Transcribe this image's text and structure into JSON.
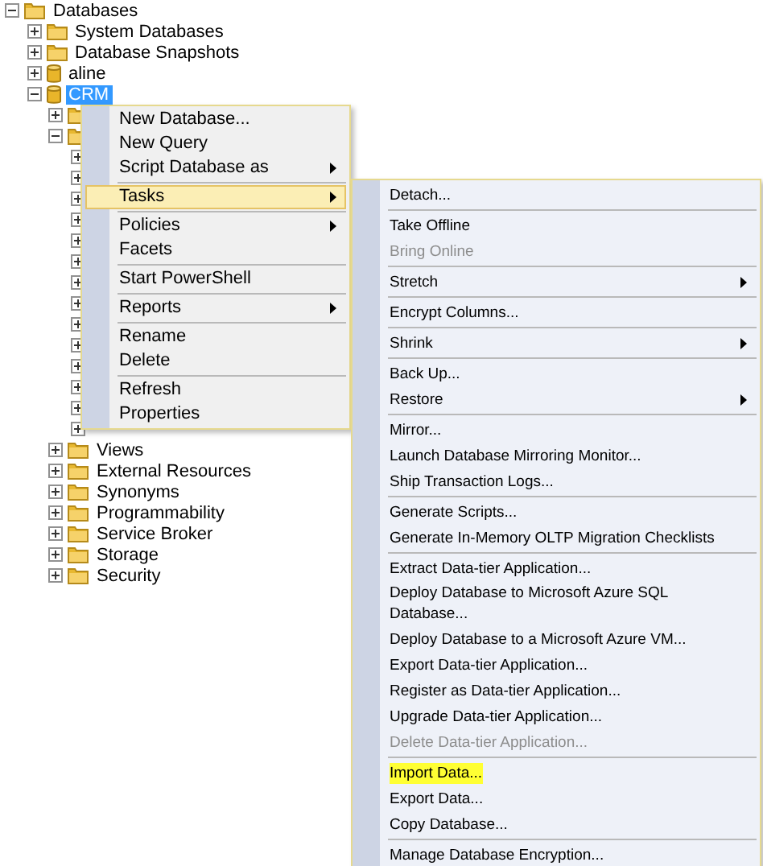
{
  "tree": [
    {
      "label": "Databases",
      "kind": "folder",
      "expanded": true,
      "selected": false,
      "children": [
        {
          "label": "System Databases",
          "kind": "folder",
          "expanded": false,
          "selected": false
        },
        {
          "label": "Database Snapshots",
          "kind": "folder",
          "expanded": false,
          "selected": false
        },
        {
          "label": "aline",
          "kind": "database",
          "expanded": false,
          "selected": false
        },
        {
          "label": "CRM",
          "kind": "database",
          "expanded": true,
          "selected": true,
          "children": [
            {
              "kind": "folder",
              "expanded": false
            },
            {
              "kind": "folder",
              "expanded": true,
              "children": [
                {
                  "expanded": false
                },
                {
                  "expanded": false
                },
                {
                  "expanded": false
                },
                {
                  "expanded": false
                },
                {
                  "expanded": false
                },
                {
                  "expanded": false
                },
                {
                  "expanded": false
                },
                {
                  "expanded": false
                },
                {
                  "expanded": false
                },
                {
                  "expanded": false
                },
                {
                  "expanded": false
                },
                {
                  "expanded": false
                },
                {
                  "expanded": false
                },
                {
                  "expanded": false
                }
              ]
            },
            {
              "label": "Views",
              "kind": "folder",
              "expanded": false,
              "selected": false
            },
            {
              "label": "External Resources",
              "kind": "folder",
              "expanded": false,
              "selected": false
            },
            {
              "label": "Synonyms",
              "kind": "folder",
              "expanded": false,
              "selected": false
            },
            {
              "label": "Programmability",
              "kind": "folder",
              "expanded": false,
              "selected": false
            },
            {
              "label": "Service Broker",
              "kind": "folder",
              "expanded": false,
              "selected": false
            },
            {
              "label": "Storage",
              "kind": "folder",
              "expanded": false,
              "selected": false
            },
            {
              "label": "Security",
              "kind": "folder",
              "expanded": false,
              "selected": false
            }
          ]
        }
      ]
    }
  ],
  "context_menu": {
    "groups": [
      [
        {
          "label": "New Database...",
          "submenu": false,
          "selected": false
        },
        {
          "label": "New Query",
          "submenu": false,
          "selected": false
        },
        {
          "label": "Script Database as",
          "submenu": true,
          "selected": false
        }
      ],
      [
        {
          "label": "Tasks",
          "submenu": true,
          "selected": true
        }
      ],
      [
        {
          "label": "Policies",
          "submenu": true,
          "selected": false
        },
        {
          "label": "Facets",
          "submenu": false,
          "selected": false
        }
      ],
      [
        {
          "label": "Start PowerShell",
          "submenu": false,
          "selected": false
        }
      ],
      [
        {
          "label": "Reports",
          "submenu": true,
          "selected": false
        }
      ],
      [
        {
          "label": "Rename",
          "submenu": false,
          "selected": false
        },
        {
          "label": "Delete",
          "submenu": false,
          "selected": false
        }
      ],
      [
        {
          "label": "Refresh",
          "submenu": false,
          "selected": false
        },
        {
          "label": "Properties",
          "submenu": false,
          "selected": false
        }
      ]
    ]
  },
  "tasks_submenu": {
    "groups": [
      [
        {
          "label": "Detach...",
          "submenu": false,
          "disabled": false,
          "highlighted": false
        }
      ],
      [
        {
          "label": "Take Offline",
          "submenu": false,
          "disabled": false,
          "highlighted": false
        },
        {
          "label": "Bring Online",
          "submenu": false,
          "disabled": true,
          "highlighted": false
        }
      ],
      [
        {
          "label": "Stretch",
          "submenu": true,
          "disabled": false,
          "highlighted": false
        }
      ],
      [
        {
          "label": "Encrypt Columns...",
          "submenu": false,
          "disabled": false,
          "highlighted": false
        }
      ],
      [
        {
          "label": "Shrink",
          "submenu": true,
          "disabled": false,
          "highlighted": false
        }
      ],
      [
        {
          "label": "Back Up...",
          "submenu": false,
          "disabled": false,
          "highlighted": false
        },
        {
          "label": "Restore",
          "submenu": true,
          "disabled": false,
          "highlighted": false
        }
      ],
      [
        {
          "label": "Mirror...",
          "submenu": false,
          "disabled": false,
          "highlighted": false
        },
        {
          "label": "Launch Database Mirroring Monitor...",
          "submenu": false,
          "disabled": false,
          "highlighted": false
        },
        {
          "label": "Ship Transaction Logs...",
          "submenu": false,
          "disabled": false,
          "highlighted": false
        }
      ],
      [
        {
          "label": "Generate Scripts...",
          "submenu": false,
          "disabled": false,
          "highlighted": false
        },
        {
          "label": "Generate In-Memory OLTP Migration Checklists",
          "submenu": false,
          "disabled": false,
          "highlighted": false
        }
      ],
      [
        {
          "label": "Extract Data-tier Application...",
          "submenu": false,
          "disabled": false,
          "highlighted": false
        },
        {
          "label": "Deploy Database to Microsoft Azure SQL Database...",
          "submenu": false,
          "disabled": false,
          "highlighted": false
        },
        {
          "label": "Deploy Database to a Microsoft Azure VM...",
          "submenu": false,
          "disabled": false,
          "highlighted": false
        },
        {
          "label": "Export Data-tier Application...",
          "submenu": false,
          "disabled": false,
          "highlighted": false
        },
        {
          "label": "Register as Data-tier Application...",
          "submenu": false,
          "disabled": false,
          "highlighted": false
        },
        {
          "label": "Upgrade Data-tier Application...",
          "submenu": false,
          "disabled": false,
          "highlighted": false
        },
        {
          "label": "Delete Data-tier Application...",
          "submenu": false,
          "disabled": true,
          "highlighted": false
        }
      ],
      [
        {
          "label": "Import Data...",
          "submenu": false,
          "disabled": false,
          "highlighted": true
        },
        {
          "label": "Export Data...",
          "submenu": false,
          "disabled": false,
          "highlighted": false
        },
        {
          "label": "Copy Database...",
          "submenu": false,
          "disabled": false,
          "highlighted": false
        }
      ],
      [
        {
          "label": "Manage Database Encryption...",
          "submenu": false,
          "disabled": false,
          "highlighted": false
        }
      ]
    ]
  }
}
